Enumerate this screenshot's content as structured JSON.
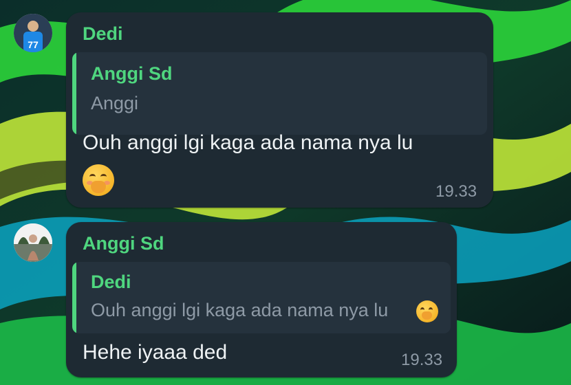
{
  "messages": [
    {
      "sender": "Dedi",
      "avatar_icon": "player-avatar-icon",
      "quote": {
        "name": "Anggi Sd",
        "text": "Anggi"
      },
      "text": "Ouh anggi lgi kaga ada nama nya lu",
      "emoji": "hand-over-mouth-emoji",
      "time": "19.33"
    },
    {
      "sender": "Anggi Sd",
      "avatar_icon": "person-avatar-icon",
      "quote": {
        "name": "Dedi",
        "text": "Ouh anggi lgi kaga ada nama nya lu"
      },
      "quote_emoji": "hand-over-mouth-emoji",
      "text": "Hehe iyaaa ded",
      "time": "19.33"
    }
  ],
  "colors": {
    "bubble": "#1e2a33",
    "quote_bg": "#25323d",
    "accent_name": "#4fd67f",
    "body_text": "#eef2f4",
    "muted_text": "#8e9aa6"
  }
}
